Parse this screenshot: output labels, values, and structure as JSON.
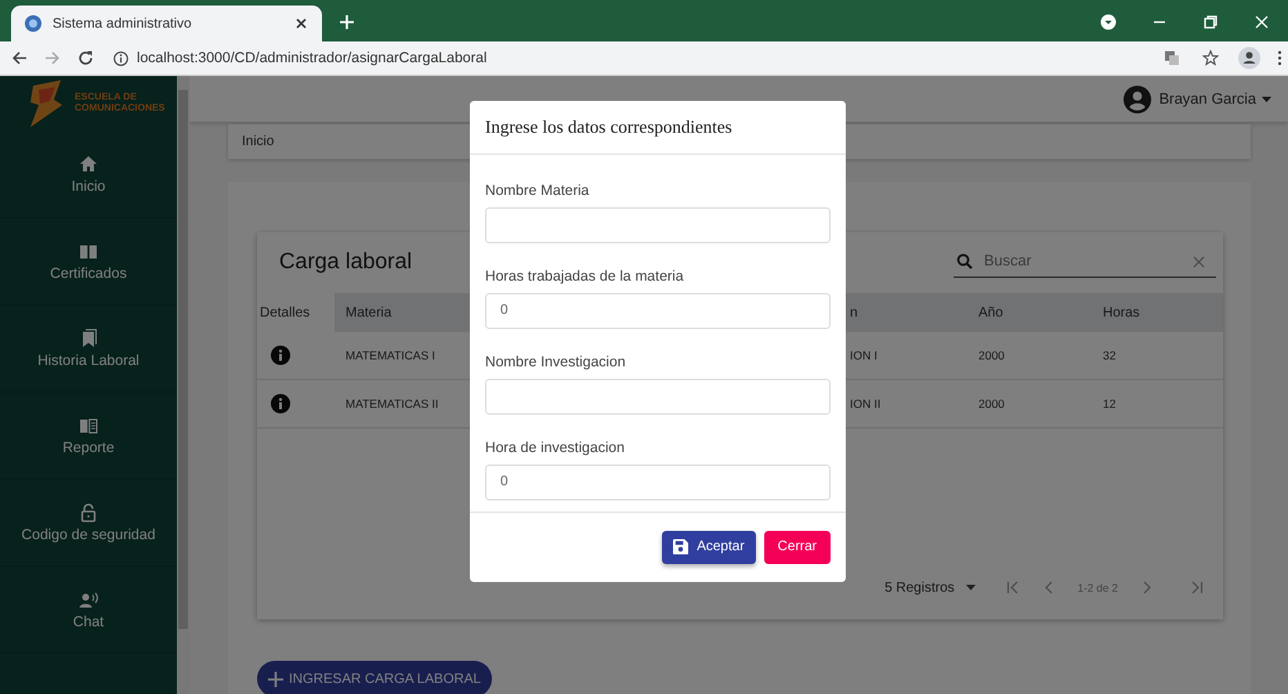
{
  "browser": {
    "tab_title": "Sistema administrativo",
    "url": "localhost:3000/CD/administrador/asignarCargaLaboral"
  },
  "sidebar": {
    "logo_lines": [
      "ESCUELA DE",
      "COMUNICACIONES"
    ],
    "items": [
      {
        "label": "Inicio"
      },
      {
        "label": "Certificados"
      },
      {
        "label": "Historia Laboral"
      },
      {
        "label": "Reporte"
      },
      {
        "label": "Codigo de seguridad"
      },
      {
        "label": "Chat"
      }
    ]
  },
  "header": {
    "user": "Brayan Garcia"
  },
  "breadcrumb": "Inicio",
  "table": {
    "title": "Carga laboral",
    "search": {
      "placeholder": "Buscar"
    },
    "details_column": "Detalles",
    "columns": [
      "Materia",
      "n",
      "Año",
      "Horas"
    ],
    "rows": [
      {
        "cells": [
          "MATEMATICAS I",
          "ION I",
          "2000",
          "32"
        ]
      },
      {
        "cells": [
          "MATEMATICAS II",
          "ION II",
          "2000",
          "12"
        ]
      }
    ],
    "pagination": {
      "page_size": "5 Registros",
      "range": "1-2 de 2"
    }
  },
  "add_button": "INGRESAR CARGA LABORAL",
  "dialog": {
    "title": "Ingrese los datos correspondientes",
    "fields": [
      {
        "label": "Nombre Materia"
      },
      {
        "label": "Horas trabajadas de la materia",
        "value": "0"
      },
      {
        "label": "Nombre Investigacion"
      },
      {
        "label": "Hora de investigacion",
        "value": "0"
      }
    ],
    "buttons": [
      {
        "label": "Aceptar",
        "kind": "primary"
      },
      {
        "label": "Cerrar",
        "kind": "danger"
      }
    ]
  }
}
